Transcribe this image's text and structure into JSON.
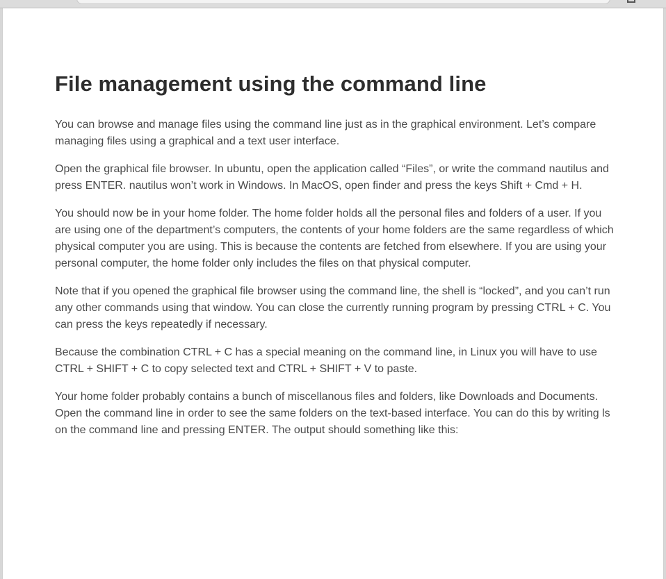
{
  "article": {
    "title": "File management using the command line",
    "paragraphs": [
      "You can browse and manage files using the command line just as in the graphical environment. Let’s compare managing files using a graphical and a text user interface.",
      "Open the graphical file browser. In ubuntu, open the application called “Files”, or write the command nautilus and press ENTER. nautilus won’t work in Windows. In MacOS, open finder and press the keys Shift + Cmd + H.",
      "You should now be in your home folder. The home folder holds all the personal files and folders of a user. If you are using one of the department’s computers, the contents of your home folders are the same regardless of which physical computer you are using. This is because the contents are fetched from elsewhere. If you are using your personal computer, the home folder only includes the files on that physical computer.",
      "Note that if you opened the graphical file browser using the command line, the shell is “locked”, and you can’t run any other commands using that window. You can close the currently running program by pressing CTRL + C. You can press the keys repeatedly if necessary.",
      "Because the combination CTRL + C has a special meaning on the command line, in Linux you will have to use CTRL + SHIFT + C to copy selected text and CTRL + SHIFT + V to paste.",
      "Your home folder probably contains a bunch of miscellanous files and folders, like Downloads and Documents. Open the command line in order to see the same folders on the text-based interface. You can do this by writing ls on the command line and pressing ENTER. The output should something like this:"
    ]
  }
}
